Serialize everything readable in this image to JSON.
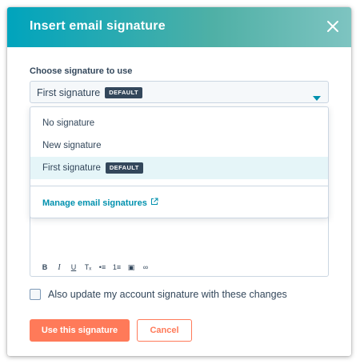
{
  "modal": {
    "title": "Insert email signature",
    "close_icon": "close-icon"
  },
  "signature_select": {
    "label": "Choose signature to use",
    "selected_value": "First signature",
    "selected_badge": "DEFAULT",
    "caret_icon": "caret-down-icon"
  },
  "dropdown": {
    "options": [
      {
        "label": "No signature",
        "badge": ""
      },
      {
        "label": "New signature",
        "badge": ""
      },
      {
        "label": "First signature",
        "badge": "DEFAULT",
        "selected": true
      }
    ],
    "manage_link": "Manage email signatures",
    "manage_link_icon": "external-link-icon"
  },
  "editor": {
    "toolbar": [
      {
        "name": "bold",
        "glyph": "B"
      },
      {
        "name": "italic",
        "glyph": "I"
      },
      {
        "name": "underline",
        "glyph": "U"
      },
      {
        "name": "clear-format",
        "glyph": "Tₓ"
      },
      {
        "name": "bulleted-list",
        "glyph": "•≡"
      },
      {
        "name": "numbered-list",
        "glyph": "1≡"
      },
      {
        "name": "insert-image",
        "glyph": "▣"
      },
      {
        "name": "insert-link",
        "glyph": "∞"
      }
    ]
  },
  "checkbox": {
    "label": "Also update my account signature with these changes",
    "checked": false
  },
  "buttons": {
    "primary": "Use this signature",
    "secondary": "Cancel"
  },
  "colors": {
    "header_start": "#00a4bd",
    "header_end": "#7ec4c1",
    "accent": "#ff7a59",
    "link": "#0091ae",
    "text": "#33475b"
  }
}
